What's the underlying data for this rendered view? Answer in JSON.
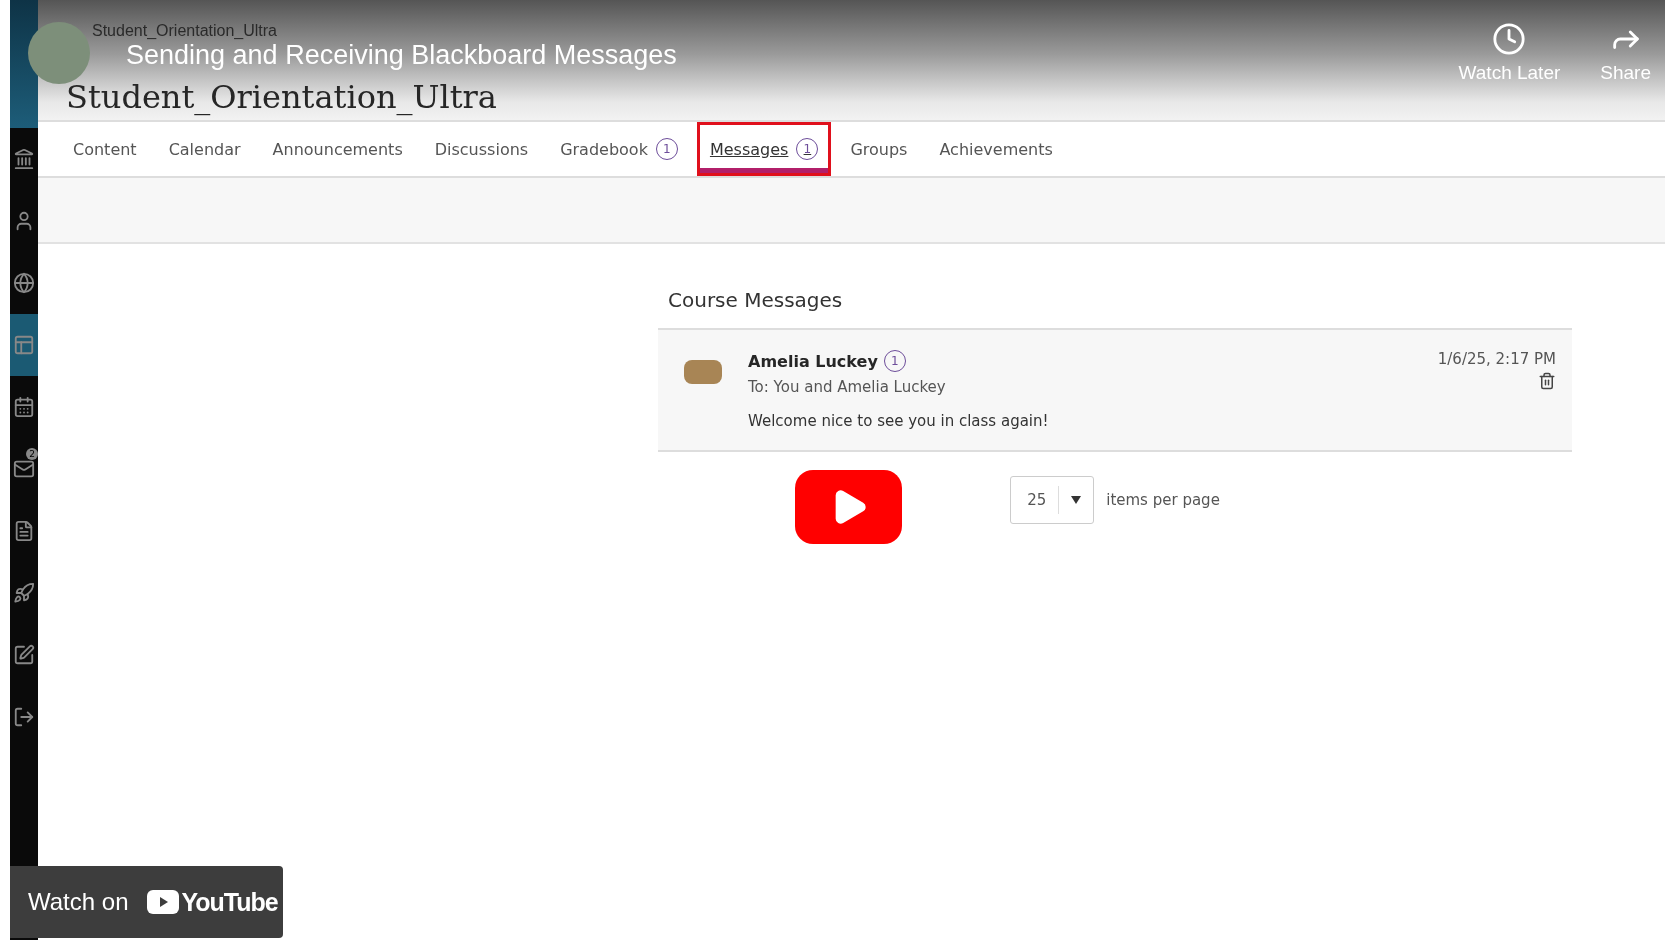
{
  "video": {
    "channel_name": "Student_Orientation_Ultra",
    "title": "Sending and Receiving Blackboard Messages",
    "actions": [
      {
        "kind": "watch_later",
        "label": "Watch Later"
      },
      {
        "kind": "share",
        "label": "Share"
      }
    ],
    "watch_on": "Watch on",
    "platform": "YouTube"
  },
  "course": {
    "title": "Student_Orientation_Ultra"
  },
  "sidebar": {
    "items": [
      {
        "kind": "institution",
        "selected": false
      },
      {
        "kind": "profile",
        "selected": false
      },
      {
        "kind": "globe",
        "selected": false
      },
      {
        "kind": "courses",
        "selected": true
      },
      {
        "kind": "calendar",
        "selected": false
      },
      {
        "kind": "messages",
        "selected": false,
        "badge": "2"
      },
      {
        "kind": "grades",
        "selected": false
      },
      {
        "kind": "tools",
        "selected": false
      },
      {
        "kind": "edit",
        "selected": false
      },
      {
        "kind": "signout",
        "selected": false
      }
    ]
  },
  "tabs": [
    {
      "label": "Content",
      "selected": false,
      "highlighted": false
    },
    {
      "label": "Calendar",
      "selected": false,
      "highlighted": false
    },
    {
      "label": "Announcements",
      "selected": false,
      "highlighted": false
    },
    {
      "label": "Discussions",
      "selected": false,
      "highlighted": false
    },
    {
      "label": "Gradebook",
      "badge": "1",
      "selected": false,
      "highlighted": false
    },
    {
      "label": "Messages",
      "badge": "1",
      "selected": true,
      "highlighted": true
    },
    {
      "label": "Groups",
      "selected": false,
      "highlighted": false
    },
    {
      "label": "Achievements",
      "selected": false,
      "highlighted": false
    }
  ],
  "messages": {
    "heading": "Course Messages",
    "items": [
      {
        "sender": "Amelia Luckey",
        "unread_count": "1",
        "recipients": "To: You and Amelia Luckey",
        "date": "1/6/25, 2:17 PM",
        "body": "Welcome nice to see you in class again!"
      }
    ]
  },
  "pagination": {
    "value": "25",
    "label": "items per page"
  }
}
